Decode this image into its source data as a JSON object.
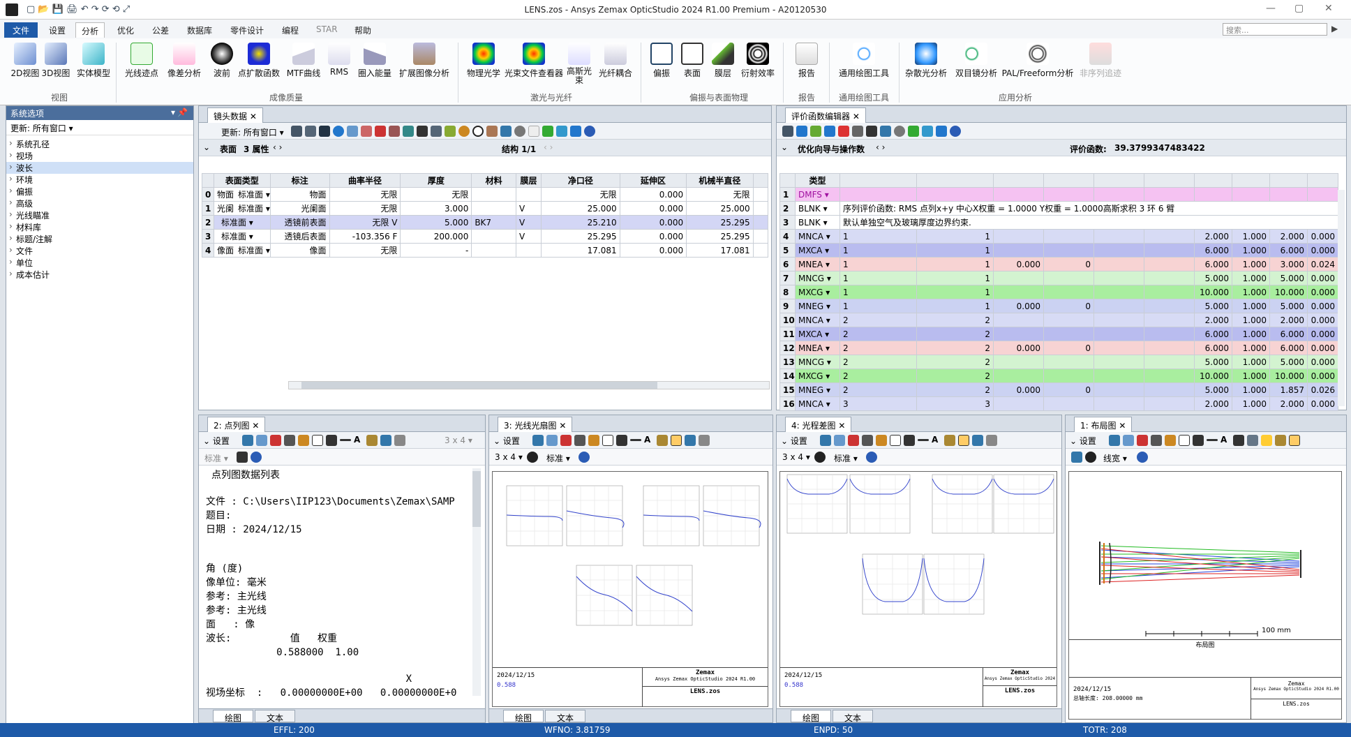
{
  "titlebar": {
    "title": "LENS.zos - Ansys Zemax OpticStudio 2024 R1.00   Premium - A20120530"
  },
  "menu": {
    "items": [
      "文件",
      "设置",
      "分析",
      "优化",
      "公差",
      "数据库",
      "零件设计",
      "编程",
      "STAR",
      "帮助"
    ],
    "search_placeholder": "搜索..."
  },
  "ribbon": {
    "buttons": [
      "2D视图",
      "3D视图",
      "实体模型",
      "光线迹点",
      "像差分析",
      "波前",
      "点扩散函数",
      "MTF曲线",
      "RMS",
      "圈入能量",
      "扩展图像分析",
      "物理光学",
      "光束文件查看器",
      "高斯光束",
      "光纤耦合",
      "偏振",
      "表面",
      "膜层",
      "衍射效率",
      "报告",
      "通用绘图工具",
      "杂散光分析",
      "双目镜分析",
      "PAL/Freeform分析",
      "非序列追迹"
    ],
    "groups": [
      "视图",
      "成像质量",
      "激光与光纤",
      "偏振与表面物理",
      "报告",
      "通用绘图工具",
      "应用分析"
    ]
  },
  "left": {
    "title": "系统选项",
    "update": "更新: 所有窗口",
    "items": [
      "系统孔径",
      "视场",
      "波长",
      "环境",
      "偏振",
      "高级",
      "光线瞄准",
      "材料库",
      "标题/注解",
      "文件",
      "单位",
      "成本估计"
    ]
  },
  "lens": {
    "tab": "镜头数据",
    "update": "更新: 所有窗口",
    "nav_label": "表面",
    "nav_props": "3 属性",
    "struct": "结构 1/1",
    "headers": [
      "",
      "表面类型",
      "标注",
      "曲率半径",
      "厚度",
      "材料",
      "膜层",
      "净口径",
      "延伸区",
      "机械半直径"
    ],
    "rows": [
      [
        "0",
        "物面",
        "标准面",
        "物面",
        "无限",
        "无限",
        "",
        "",
        "无限",
        "0.000",
        "无限"
      ],
      [
        "1",
        "光阑",
        "标准面",
        "光阑面",
        "无限",
        "3.000",
        "V",
        "",
        "25.000",
        "0.000",
        "25.000"
      ],
      [
        "2",
        "",
        "标准面",
        "透镜前表面",
        "无限 V",
        "5.000",
        "V",
        "BK7",
        "25.210",
        "0.000",
        "25.295"
      ],
      [
        "3",
        "",
        "标准面",
        "透镜后表面",
        "-103.356 F",
        "200.000",
        "V",
        "",
        "25.295",
        "0.000",
        "25.295"
      ],
      [
        "4",
        "像面",
        "标准面",
        "像面",
        "无限",
        "-",
        "",
        "",
        "17.081",
        "0.000",
        "17.081"
      ]
    ]
  },
  "merit": {
    "tab": "评价函数编辑器",
    "nav_label": "优化向导与操作数",
    "value_label": "评价函数:",
    "value": "39.3799347483422",
    "col_type": "类型",
    "rows": [
      {
        "n": "1",
        "type": "DMFS",
        "a": "",
        "b": "",
        "c": "",
        "d": "",
        "e": "",
        "f": "",
        "g": "",
        "h": "",
        "color": "#f5c2f2"
      },
      {
        "n": "2",
        "type": "BLNK",
        "text": "序列评价函数: RMS 点列x+y 中心X权重 = 1.0000 Y权重 = 1.0000高斯求积 3 环 6 臂",
        "color": "#ffffff"
      },
      {
        "n": "3",
        "type": "BLNK",
        "text": "默认单独空气及玻璃厚度边界约束.",
        "color": "#ffffff"
      },
      {
        "n": "4",
        "type": "MNCA",
        "a": "1",
        "b": "1",
        "c": "",
        "d": "",
        "e": "2.000",
        "f": "1.000",
        "g": "2.000",
        "h": "0.000",
        "color": "#d7dbf5"
      },
      {
        "n": "5",
        "type": "MXCA",
        "a": "1",
        "b": "1",
        "c": "",
        "d": "",
        "e": "6.000",
        "f": "1.000",
        "g": "6.000",
        "h": "0.000",
        "color": "#b9bcef"
      },
      {
        "n": "6",
        "type": "MNEA",
        "a": "1",
        "b": "1",
        "c": "0.000",
        "d": "0",
        "e": "6.000",
        "f": "1.000",
        "g": "3.000",
        "h": "0.024",
        "color": "#f7d3d3"
      },
      {
        "n": "7",
        "type": "MNCG",
        "a": "1",
        "b": "1",
        "c": "",
        "d": "",
        "e": "5.000",
        "f": "1.000",
        "g": "5.000",
        "h": "0.000",
        "color": "#d3f3d0"
      },
      {
        "n": "8",
        "type": "MXCG",
        "a": "1",
        "b": "1",
        "c": "",
        "d": "",
        "e": "10.000",
        "f": "1.000",
        "g": "10.000",
        "h": "0.000",
        "color": "#a9ee9f"
      },
      {
        "n": "9",
        "type": "MNEG",
        "a": "1",
        "b": "1",
        "c": "0.000",
        "d": "0",
        "e": "5.000",
        "f": "1.000",
        "g": "5.000",
        "h": "0.000",
        "color": "#cbd2f2"
      },
      {
        "n": "10",
        "type": "MNCA",
        "a": "2",
        "b": "2",
        "c": "",
        "d": "",
        "e": "2.000",
        "f": "1.000",
        "g": "2.000",
        "h": "0.000",
        "color": "#d7dbf5"
      },
      {
        "n": "11",
        "type": "MXCA",
        "a": "2",
        "b": "2",
        "c": "",
        "d": "",
        "e": "6.000",
        "f": "1.000",
        "g": "6.000",
        "h": "0.000",
        "color": "#b9bcef"
      },
      {
        "n": "12",
        "type": "MNEA",
        "a": "2",
        "b": "2",
        "c": "0.000",
        "d": "0",
        "e": "6.000",
        "f": "1.000",
        "g": "6.000",
        "h": "0.000",
        "color": "#f7d3d3"
      },
      {
        "n": "13",
        "type": "MNCG",
        "a": "2",
        "b": "2",
        "c": "",
        "d": "",
        "e": "5.000",
        "f": "1.000",
        "g": "5.000",
        "h": "0.000",
        "color": "#d3f3d0"
      },
      {
        "n": "14",
        "type": "MXCG",
        "a": "2",
        "b": "2",
        "c": "",
        "d": "",
        "e": "10.000",
        "f": "1.000",
        "g": "10.000",
        "h": "0.000",
        "color": "#a9ee9f"
      },
      {
        "n": "15",
        "type": "MNEG",
        "a": "2",
        "b": "2",
        "c": "0.000",
        "d": "0",
        "e": "5.000",
        "f": "1.000",
        "g": "1.857",
        "h": "0.026",
        "color": "#cbd2f2"
      },
      {
        "n": "16",
        "type": "MNCA",
        "a": "3",
        "b": "3",
        "c": "",
        "d": "",
        "e": "2.000",
        "f": "1.000",
        "g": "2.000",
        "h": "0.000",
        "color": "#d7dbf5"
      }
    ]
  },
  "spot": {
    "tab": "2: 点列图",
    "settings": "设置",
    "grid": "3 x 4",
    "std": "标准",
    "lines": [
      "点列图数据列表",
      "",
      "文件 : C:\\Users\\IIP123\\Documents\\Zemax\\SAMP",
      "题目:",
      "日期 : 2024/12/15",
      "",
      "",
      "角 (度)",
      "像单位: 毫米",
      "参考: 主光线",
      "参考: 主光线",
      "面   : 像",
      "波长:          值   权重",
      "            0.588000  1.00",
      "",
      "                                  X",
      "视场坐标  :   0.00000000E+00   0.00000000E+0"
    ],
    "tabs": [
      "绘图",
      "文本"
    ]
  },
  "fan": {
    "tab": "3: 光线光扇图",
    "settings": "设置",
    "grid": "3 x 4",
    "std": "标准",
    "date": "2024/12/15",
    "wl": "0.588",
    "brand": "Zemax",
    "product": "Ansys Zemax OpticStudio 2024 R1.00",
    "file": "LENS.zos",
    "tabs": [
      "绘图",
      "文本"
    ]
  },
  "opd": {
    "tab": "4: 光程差图",
    "settings": "设置",
    "grid": "3 x 4",
    "std": "标准",
    "date": "2024/12/15",
    "wl": "0.588",
    "brand": "Zemax",
    "product": "Ansys Zemax OpticStudio 2024",
    "file": "LENS.zos",
    "tabs": [
      "绘图",
      "文本"
    ]
  },
  "layout": {
    "tab": "1: 布局图",
    "settings": "设置",
    "line": "线宽",
    "scale": "100 mm",
    "caption": "布局图",
    "date": "2024/12/15",
    "total": "总轴长度: 208.00000 mm",
    "brand": "Zemax",
    "product": "Ansys Zemax OpticStudio 2024 R1.00",
    "file": "LENS.zos"
  },
  "status": {
    "effl": "EFFL: 200",
    "wfno": "WFNO: 3.81759",
    "enpd": "ENPD: 50",
    "totr": "TOTR: 208"
  },
  "colors": {
    "accent": "#1e5aa8"
  }
}
